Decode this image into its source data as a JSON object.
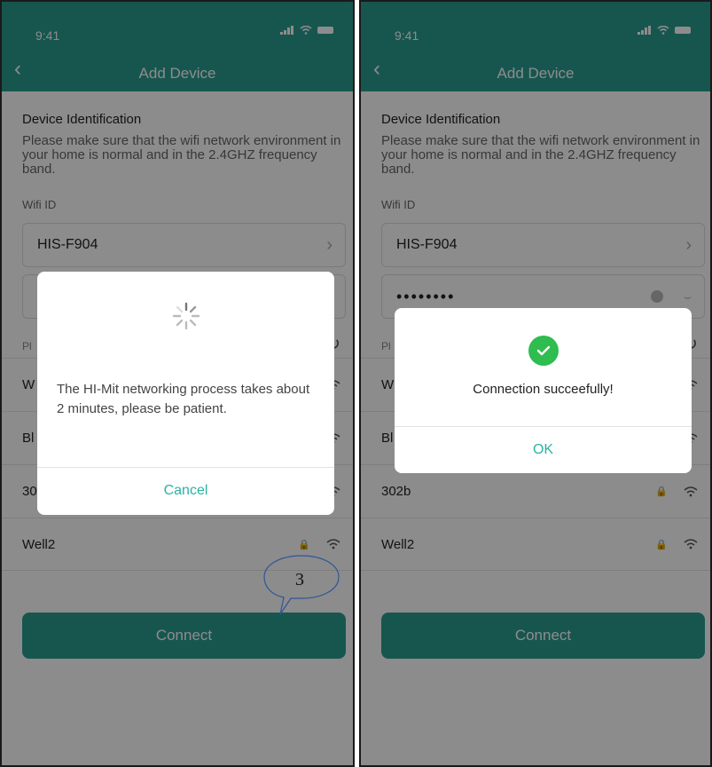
{
  "screens": [
    {
      "status_time": "9:41",
      "title": "Add Device",
      "section_title": "Device Identification",
      "description": "Please make sure that the wifi network environment in your home is normal and in the 2.4GHZ frequency band.",
      "wifi_label": "Wifi ID",
      "wifi_value": "HIS-F904",
      "hint_prefix": "Pl",
      "networks": [
        {
          "name": "W"
        },
        {
          "name": "Bl"
        },
        {
          "name": "30"
        },
        {
          "name": "Well2"
        }
      ],
      "connect_label": "Connect",
      "dialog": {
        "message": "The HI-Mit networking process takes about 2 minutes, please be patient.",
        "cancel_label": "Cancel"
      },
      "annotation": "3"
    },
    {
      "status_time": "9:41",
      "title": "Add Device",
      "section_title": "Device Identification",
      "description": "Please make sure that the wifi network environment in your home is normal and in the 2.4GHZ frequency band.",
      "wifi_label": "Wifi ID",
      "wifi_value": "HIS-F904",
      "password_mask": "••••••••",
      "hint_prefix": "Pl",
      "networks": [
        {
          "name": "W"
        },
        {
          "name": "Bl"
        },
        {
          "name": "302b"
        },
        {
          "name": "Well2"
        }
      ],
      "connect_label": "Connect",
      "dialog": {
        "message": "Connection succeefully!",
        "ok_label": "OK"
      }
    }
  ],
  "colors": {
    "header": "#2a9d91",
    "accent": "#2ab3a4",
    "success": "#2ebd4e"
  }
}
